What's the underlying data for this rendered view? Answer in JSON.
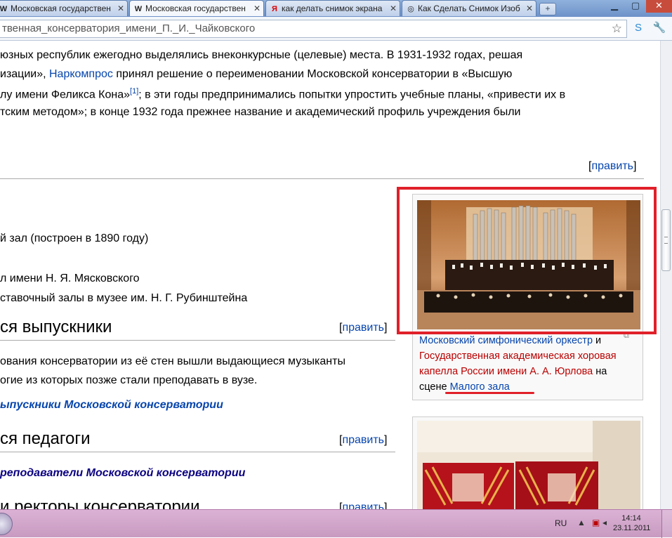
{
  "tabs": [
    {
      "icon": "W",
      "label": "Московская государствен",
      "active": false
    },
    {
      "icon": "W",
      "label": "Московская государствен",
      "active": true
    },
    {
      "icon": "Я",
      "label": "как делать снимок экрана",
      "active": false
    },
    {
      "icon": "◎",
      "label": "Как Сделать Снимок Изоб",
      "active": false
    }
  ],
  "toolbar": {
    "url": "твенная_консерватория_имени_П._И._Чайковского"
  },
  "article": {
    "line1": "юзных республик ежегодно выделялись внеконкурсные (целевые) места. В 1931-1932 годах, решая",
    "line2_pre": "изации», ",
    "line2_link": "Наркомпрос",
    "line2_post": " принял решение о переименовании Московской консерватории в «Высшую",
    "line3_pre": "лу имени Феликса Кона»",
    "line3_ref": "[1]",
    "line3_post": "; в эти годы предпринимались попытки упростить учебные планы, «привести их в",
    "line4": "тским методом»; в конце 1932 года прежнее название и академический профиль учреждения были",
    "edit_label": "править",
    "list1": "й зал (построен в 1890 году)",
    "list2": "л имени Н. Я. Мясковского",
    "list3": "ставочный залы в музее им. Н. Г. Рубинштейна",
    "h_alumni": "ся выпускники",
    "alumni_p1": "ования консерватории из её стен вышли выдающиеся музыканты",
    "alumni_p2": "огие из которых позже стали преподавать в вузе.",
    "alumni_link": "ыпускники Московской консерватории",
    "h_teachers": "ся педагоги",
    "teachers_link": "реподаватели Московской консерватории",
    "h_rectors": "и ректоры консерватории"
  },
  "thumb": {
    "cap_link1": "Московский симфонический оркестр",
    "cap_and": " и",
    "cap_link2a": "Государственная академическая хоровая",
    "cap_link2b": "капелла России имени А. А. Юрлова",
    "cap_on": " на",
    "cap_stage": "сцене ",
    "cap_link3": "Малого зала"
  },
  "taskbar": {
    "lang": "RU",
    "time": "14:14",
    "date": "23.11.2011"
  },
  "colors": {
    "link": "#0645ad",
    "redlink": "#ba0000",
    "highlight": "#e0202a"
  }
}
